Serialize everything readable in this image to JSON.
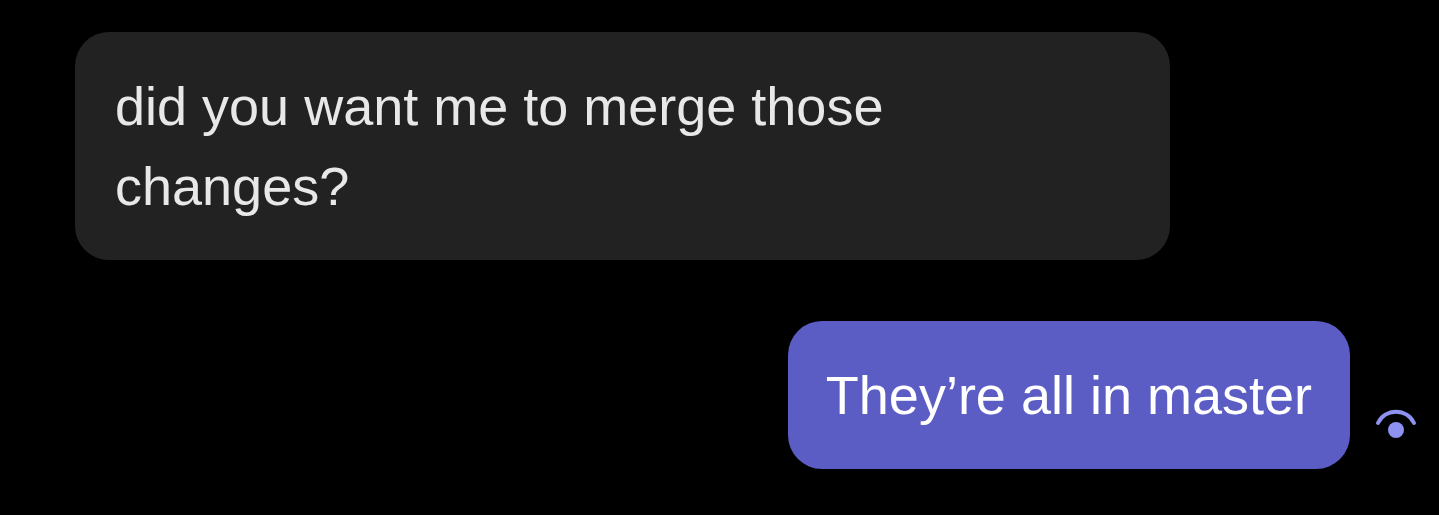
{
  "messages": [
    {
      "kind": "incoming",
      "text": "did you want me to merge those changes?",
      "seen": false
    },
    {
      "kind": "outgoing",
      "text": "They’re all in master",
      "seen": true
    }
  ]
}
